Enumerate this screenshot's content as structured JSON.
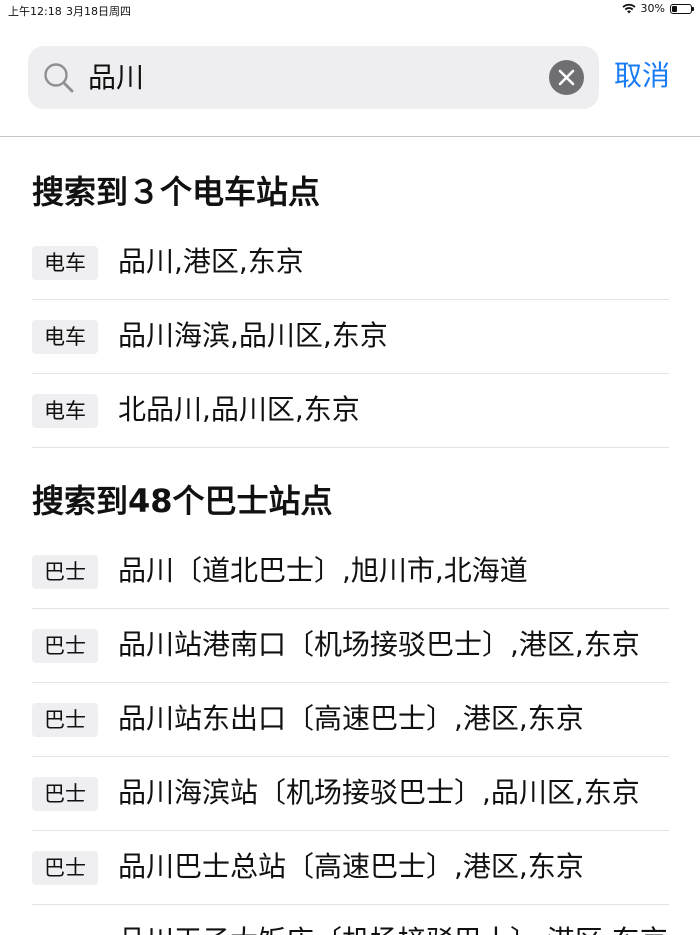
{
  "status_bar": {
    "time": "上午12:18",
    "date": "3月18日周四",
    "battery": "30%",
    "battery_level": 0.3
  },
  "search": {
    "query": "品川",
    "cancel_label": "取消"
  },
  "train_section": {
    "title": "搜索到３个电车站点",
    "items": [
      {
        "badge": "电车",
        "label": "品川,港区,东京"
      },
      {
        "badge": "电车",
        "label": "品川海滨,品川区,东京"
      },
      {
        "badge": "电车",
        "label": "北品川,品川区,东京"
      }
    ]
  },
  "bus_section": {
    "title": "搜索到48个巴士站点",
    "items": [
      {
        "badge": "巴士",
        "label": "品川〔道北巴士〕,旭川市,北海道"
      },
      {
        "badge": "巴士",
        "label": "品川站港南口〔机场接驳巴士〕,港区,东京"
      },
      {
        "badge": "巴士",
        "label": "品川站东出口〔高速巴士〕,港区,东京"
      },
      {
        "badge": "巴士",
        "label": "品川海滨站〔机场接驳巴士〕,品川区,东京"
      },
      {
        "badge": "巴士",
        "label": "品川巴士总站〔高速巴士〕,港区,东京"
      },
      {
        "badge": "",
        "label": "品川王子大饭店〔机场接驳巴士〕,港区,东京"
      }
    ]
  },
  "colors": {
    "accent": "#1a7cf5",
    "badge_bg": "#efeff1",
    "search_bg": "#eeeef0"
  }
}
